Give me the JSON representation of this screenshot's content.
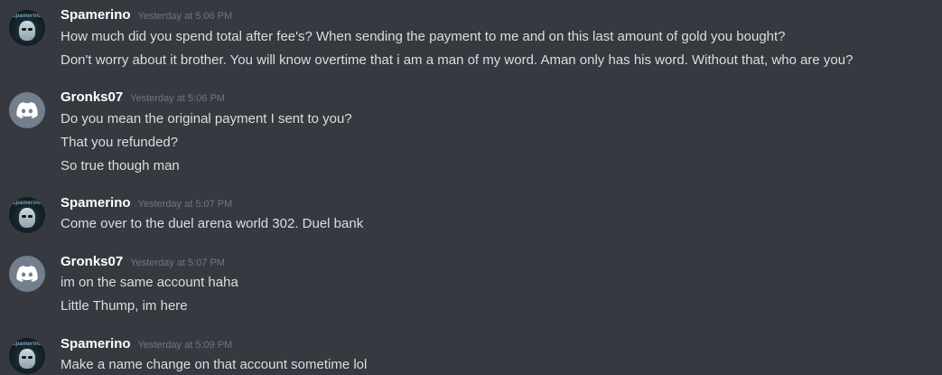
{
  "messages": [
    {
      "username": "Spamerino",
      "timestamp": "Yesterday at 5:06 PM",
      "avatar": "spamerino-avatar",
      "avatar_logo_text": "spamerino",
      "lines": [
        "How much did you spend total after fee's? When sending the payment to me and on this last amount of gold you bought?",
        "Don't worry about it brother. You will know overtime that i am a man of my word. Aman only has his word. Without that, who are you?"
      ]
    },
    {
      "username": "Gronks07",
      "timestamp": "Yesterday at 5:06 PM",
      "avatar": "discord-default-avatar",
      "lines": [
        "Do you mean the original payment I sent to you?",
        "That you refunded?",
        "So true though man"
      ]
    },
    {
      "username": "Spamerino",
      "timestamp": "Yesterday at 5:07 PM",
      "avatar": "spamerino-avatar",
      "avatar_logo_text": "spamerino",
      "lines": [
        "Come over to the duel arena world 302. Duel bank"
      ]
    },
    {
      "username": "Gronks07",
      "timestamp": "Yesterday at 5:07 PM",
      "avatar": "discord-default-avatar",
      "lines": [
        "im on the same account haha",
        "Little Thump, im here"
      ]
    },
    {
      "username": "Spamerino",
      "timestamp": "Yesterday at 5:09 PM",
      "avatar": "spamerino-avatar",
      "avatar_logo_text": "spamerino",
      "lines": [
        "Make a name change on that account sometime lol"
      ]
    }
  ],
  "colors": {
    "background": "#36393f",
    "username": "#ffffff",
    "timestamp": "#72767d",
    "message_text": "#dcddde",
    "discord_avatar_bg": "#747f8d"
  }
}
